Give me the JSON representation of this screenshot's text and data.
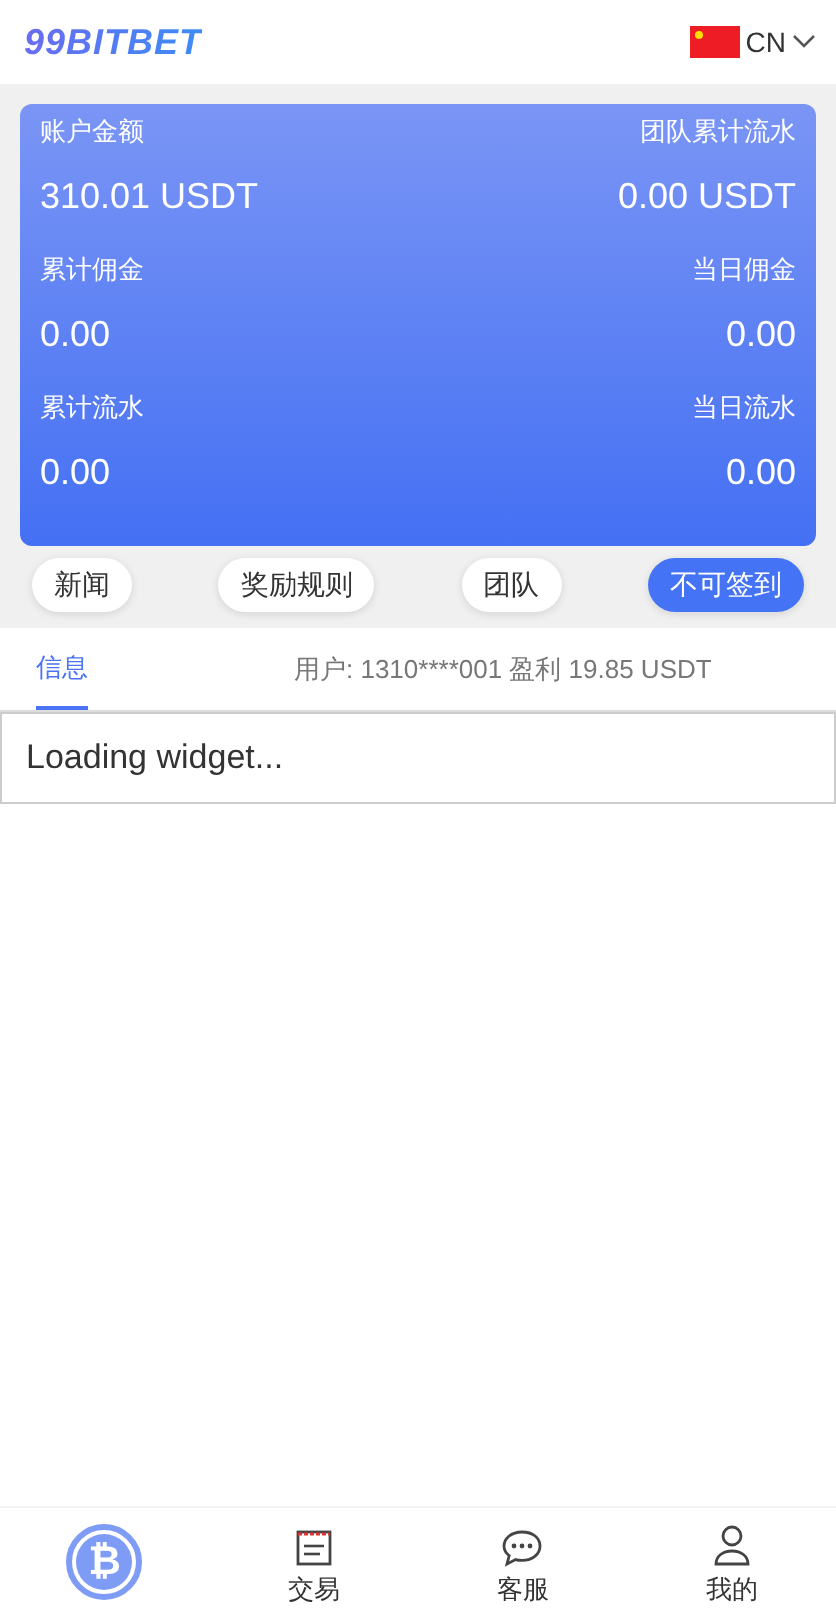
{
  "header": {
    "logo": "99BITBET",
    "language": "CN"
  },
  "stats": [
    {
      "left_label": "账户金额",
      "left_value": "310.01 USDT",
      "right_label": "团队累计流水",
      "right_value": "0.00 USDT"
    },
    {
      "left_label": "累计佣金",
      "left_value": "0.00",
      "right_label": "当日佣金",
      "right_value": "0.00"
    },
    {
      "left_label": "累计流水",
      "left_value": "0.00",
      "right_label": "当日流水",
      "right_value": "0.00"
    }
  ],
  "actions": [
    {
      "label": "新闻",
      "selected": false
    },
    {
      "label": "奖励规则",
      "selected": false
    },
    {
      "label": "团队",
      "selected": false
    },
    {
      "label": "不可签到",
      "selected": true
    }
  ],
  "tabs": [
    {
      "label": "信息",
      "selected": true
    }
  ],
  "ticker": "用户: 1310****001 盈利 19.85 USDT",
  "widget": "Loading widget...",
  "nav": [
    {
      "kind": "coin",
      "label": "₿"
    },
    {
      "kind": "trade",
      "label": "交易"
    },
    {
      "kind": "chat",
      "label": "客服"
    },
    {
      "kind": "user",
      "label": "我的"
    }
  ]
}
